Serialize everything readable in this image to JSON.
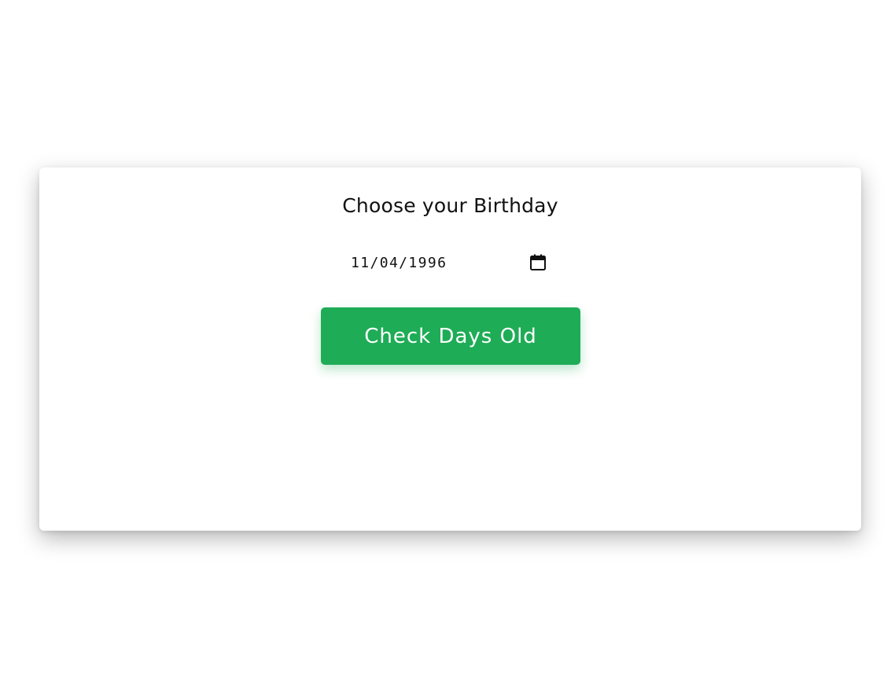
{
  "form": {
    "title": "Choose your Birthday",
    "date_value": "11/04/1996",
    "button_label": "Check Days Old"
  },
  "icons": {
    "calendar": "calendar-icon"
  },
  "colors": {
    "button_background": "#1eac56",
    "button_text": "#ffffff",
    "title_text": "#111111",
    "page_background": "#ffffff"
  }
}
